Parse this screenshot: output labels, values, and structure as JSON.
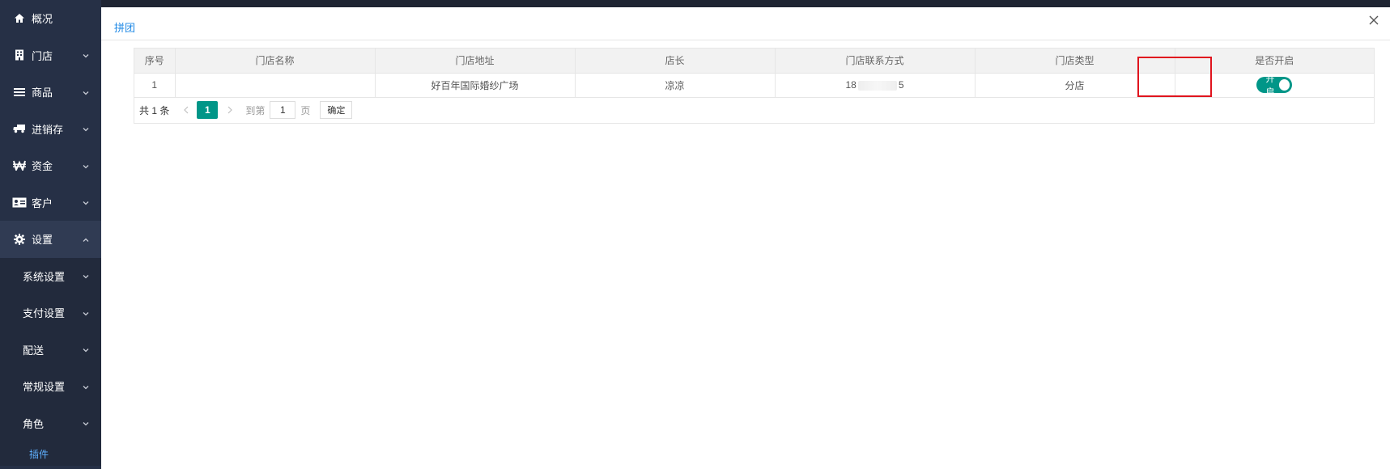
{
  "sidebar": {
    "items": [
      {
        "label": "概况",
        "icon": "home-icon"
      },
      {
        "label": "门店",
        "icon": "building-icon"
      },
      {
        "label": "商品",
        "icon": "list-icon"
      },
      {
        "label": "进销存",
        "icon": "truck-icon"
      },
      {
        "label": "资金",
        "icon": "won-icon"
      },
      {
        "label": "客户",
        "icon": "id-card-icon"
      },
      {
        "label": "设置",
        "icon": "gear-icon"
      }
    ],
    "sub_items": [
      {
        "label": "系统设置"
      },
      {
        "label": "支付设置"
      },
      {
        "label": "配送"
      },
      {
        "label": "常规设置"
      },
      {
        "label": "角色"
      }
    ],
    "active_item": "插件"
  },
  "panel": {
    "title": "拼团",
    "close_icon": "close-icon"
  },
  "table": {
    "headers": [
      "序号",
      "门店名称",
      "门店地址",
      "店长",
      "门店联系方式",
      "门店类型",
      "是否开启"
    ],
    "rows": [
      {
        "index": "1",
        "name": "",
        "address": "好百年国际婚纱广场",
        "manager": "凉凉",
        "phone_prefix": "18",
        "phone_suffix": "5",
        "type": "分店",
        "switch_label": "开启",
        "switch_on": true
      }
    ]
  },
  "pager": {
    "total": "共 1 条",
    "current": "1",
    "goto_label": "到第",
    "goto_value": "1",
    "page_label": "页",
    "confirm_label": "确定"
  },
  "colors": {
    "sidebar_bg": "#263046",
    "accent": "#009688",
    "title_blue": "#1e88e5",
    "highlight_red": "#e0141e"
  }
}
